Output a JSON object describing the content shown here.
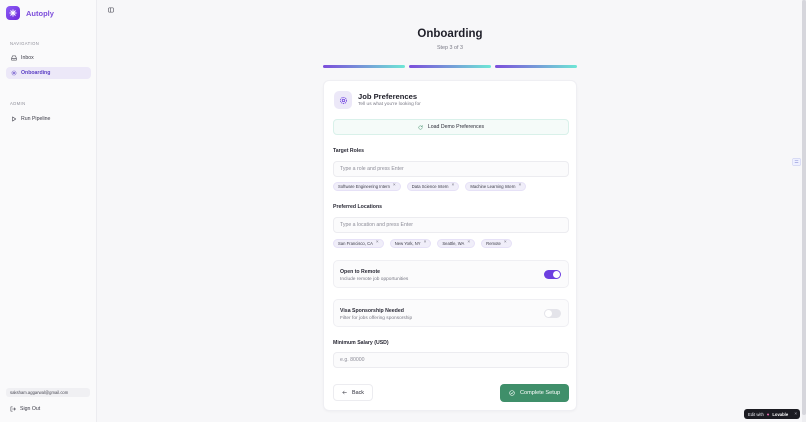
{
  "app": {
    "name": "Autoply"
  },
  "sidebar": {
    "sections": [
      {
        "label": "NAVIGATION"
      },
      {
        "label": "ADMIN"
      }
    ],
    "items": [
      {
        "label": "Inbox",
        "icon": "inbox-icon"
      },
      {
        "label": "Onboarding",
        "icon": "gear-icon",
        "active": true
      },
      {
        "label": "Run Pipeline",
        "icon": "play-icon"
      }
    ],
    "user_email": "saksham.aggarwal@gmail.com",
    "signout_label": "Sign Out"
  },
  "header": {
    "title": "Onboarding",
    "step": "Step 3 of 3",
    "progress_steps_complete": 3,
    "progress_steps_total": 3
  },
  "card": {
    "title": "Job Preferences",
    "subtitle": "Tell us what you're looking for",
    "demo_button": "Load Demo Preferences",
    "target_roles": {
      "label": "Target Roles",
      "placeholder": "Type a role and press Enter",
      "chips": [
        "Software Engineering Intern",
        "Data Science Intern",
        "Machine Learning Intern"
      ]
    },
    "locations": {
      "label": "Preferred Locations",
      "placeholder": "Type a location and press Enter",
      "chips": [
        "San Francisco, CA",
        "New York, NY",
        "Seattle, WA",
        "Remote"
      ]
    },
    "remote_toggle": {
      "title": "Open to Remote",
      "subtitle": "Include remote job opportunities",
      "on": true
    },
    "visa_toggle": {
      "title": "Visa Sponsorship Needed",
      "subtitle": "Filter for jobs offering sponsorship",
      "on": false
    },
    "salary": {
      "label": "Minimum Salary (USD)",
      "placeholder": "e.g. 80000",
      "value": ""
    },
    "back_label": "Back",
    "complete_label": "Complete Setup"
  },
  "badge": {
    "prefix": "Edit with",
    "brand": "Lovable",
    "close": "×"
  },
  "colors": {
    "accent": "#7c4ddb",
    "success": "#3f8f6a",
    "toggle_on": "#6d3fe0"
  }
}
